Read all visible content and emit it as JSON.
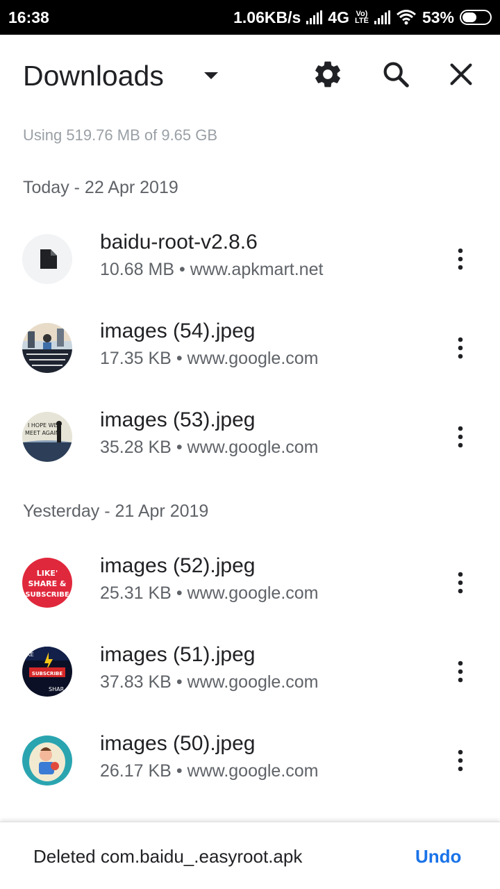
{
  "status_bar": {
    "time": "16:38",
    "net_speed": "1.06KB/s",
    "network": "4G",
    "volte_top": "Vo)",
    "volte_bottom": "LTE",
    "battery": "53%",
    "battery_level": 0.53
  },
  "header": {
    "title": "Downloads",
    "icons": [
      "chevron-down-icon",
      "gear-icon",
      "search-icon",
      "close-icon"
    ]
  },
  "storage_text": "Using 519.76 MB of 9.65 GB",
  "sections": [
    {
      "label": "Today - 22 Apr 2019",
      "items": [
        {
          "name": "baidu-root-v2.8.6",
          "size": "10.68 MB",
          "source": "www.apkmart.net",
          "thumb": "file-icon"
        },
        {
          "name": "images (54).jpeg",
          "size": "17.35 KB",
          "source": "www.google.com",
          "thumb": "image-thumbnail",
          "thumb_text": ""
        },
        {
          "name": "images (53).jpeg",
          "size": "35.28 KB",
          "source": "www.google.com",
          "thumb": "image-thumbnail",
          "thumb_text": "I HOPE WE MEET AGAIN."
        }
      ]
    },
    {
      "label": "Yesterday - 21 Apr 2019",
      "items": [
        {
          "name": "images (52).jpeg",
          "size": "25.31 KB",
          "source": "www.google.com",
          "thumb": "image-thumbnail",
          "thumb_text": "LIKE' SHARE & SUBSCRIBE"
        },
        {
          "name": "images (51).jpeg",
          "size": "37.83 KB",
          "source": "www.google.com",
          "thumb": "image-thumbnail",
          "thumb_text": "SUBSCRIBE"
        },
        {
          "name": "images (50).jpeg",
          "size": "26.17 KB",
          "source": "www.google.com",
          "thumb": "image-thumbnail",
          "thumb_text": ""
        }
      ]
    }
  ],
  "separator": "•",
  "snackbar": {
    "message": "Deleted com.baidu_.easyroot.apk",
    "action": "Undo"
  },
  "colors": {
    "accent": "#1a73e8",
    "primary_text": "#202124",
    "secondary_text": "#5f6368"
  }
}
